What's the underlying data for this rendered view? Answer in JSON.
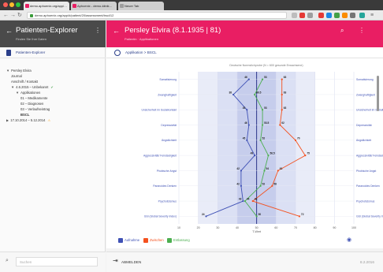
{
  "browser": {
    "tabs": [
      {
        "label": "demo.aphoenix.org/app/…",
        "active": true
      },
      {
        "label": "Aphoenix - demo-klinik…",
        "active": false
      },
      {
        "label": "Neuer Tab",
        "active": false
      }
    ],
    "url": "demo.aphoenix.org/app/#/patient/20/assessment/bsci/12"
  },
  "sidebar": {
    "title": "Patienten-Explorer",
    "subtitle": "Finden Sie Ihre Daten",
    "section": "Patienten-Explorer",
    "tree": [
      {
        "label": "Persley Elvira",
        "level": 0,
        "marker": "▼"
      },
      {
        "label": "Journal",
        "level": 1,
        "marker": ""
      },
      {
        "label": "Anschrift / Kontakt",
        "level": 1,
        "marker": ""
      },
      {
        "label": "4.6.2015 – Unbekannt",
        "level": 1,
        "marker": "▼",
        "check": "✔"
      },
      {
        "label": "Applikationen",
        "level": 2,
        "marker": "▼"
      },
      {
        "label": "01 – Medikamente",
        "level": 3,
        "marker": ""
      },
      {
        "label": "02 – Diagnosen",
        "level": 3,
        "marker": ""
      },
      {
        "label": "03 – Verlaufseintrag",
        "level": 3,
        "marker": ""
      },
      {
        "label": "BSCL",
        "level": 3,
        "marker": "",
        "bold": true
      },
      {
        "label": "17.10.2014 – 5.12.2014",
        "level": 0,
        "marker": "▶",
        "warn": "⚠"
      }
    ],
    "search_placeholder": "Suchen"
  },
  "header": {
    "patient": "Persley Elvira (8.1.1935 | 81)",
    "subtitle": "Patientin · Applikationen",
    "breadcrumb": "Applikation > BSCL"
  },
  "chart_data": {
    "type": "line",
    "title": "Deutsche Normstichprobe (N = 600 gesunde Erwachsene)",
    "xlabel": "T-Wert",
    "xlim": [
      10,
      100
    ],
    "xticks": [
      10,
      20,
      30,
      40,
      50,
      60,
      70,
      80,
      90,
      100
    ],
    "categories": [
      "Somatisierung",
      "Zwanghaftigkeit",
      "Unsicherheit im Sozialkontakt",
      "Depressivität",
      "Ängstlichkeit",
      "Aggressivität/ Feindseligkeit",
      "Phobische Angst",
      "Paranoides Denken",
      "Psychotizismus",
      "GSI (Global Severity Index)"
    ],
    "series": [
      {
        "name": "Aufnahme",
        "color": "#3f51b5",
        "values": [
          46,
          38,
          45,
          46,
          45,
          49,
          42,
          42,
          43,
          24
        ]
      },
      {
        "name": "Zwischen",
        "color": "#f4511e",
        "values": [
          63,
          63,
          63,
          62,
          70,
          75,
          61,
          58,
          48,
          72
        ]
      },
      {
        "name": "Entlassung",
        "color": "#4caf50",
        "values": [
          53,
          49,
          53,
          53,
          52,
          56,
          54,
          52,
          44,
          50
        ]
      }
    ],
    "series_labels": [
      [
        "46",
        "38",
        "45",
        "46",
        "45",
        "49",
        "42",
        "42",
        "43",
        "24"
      ],
      [
        "63",
        "63",
        "63",
        "62",
        "70",
        "75",
        "61",
        "58",
        "48",
        "72"
      ],
      [
        "53",
        "49.5",
        "53",
        "53.5",
        "52",
        "56.5",
        "54",
        "52",
        "44",
        "50"
      ]
    ]
  },
  "legend": [
    {
      "label": "Aufnahme",
      "color": "#3f51b5"
    },
    {
      "label": "Zwischen",
      "color": "#f4511e"
    },
    {
      "label": "Entlassung",
      "color": "#4caf50"
    }
  ],
  "footer": {
    "logout": "ABMELDEN",
    "date": "8.2.2016"
  }
}
